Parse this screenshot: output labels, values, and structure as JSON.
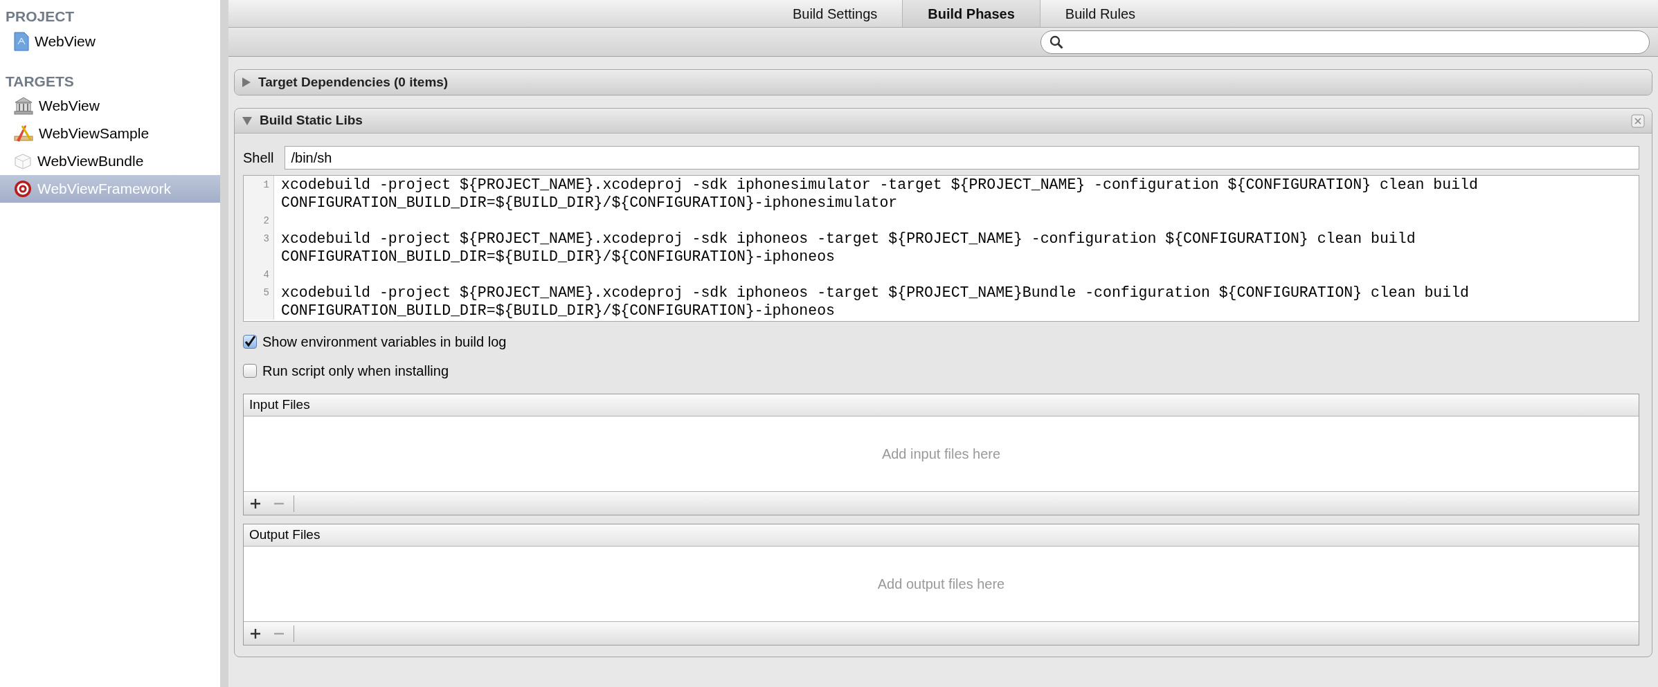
{
  "sidebar": {
    "sections": [
      {
        "heading": "PROJECT",
        "items": [
          {
            "label": "WebView",
            "kind": "project",
            "selected": false
          }
        ]
      },
      {
        "heading": "TARGETS",
        "items": [
          {
            "label": "WebView",
            "kind": "library",
            "selected": false
          },
          {
            "label": "WebViewSample",
            "kind": "app",
            "selected": false
          },
          {
            "label": "WebViewBundle",
            "kind": "bundle",
            "selected": false
          },
          {
            "label": "WebViewFramework",
            "kind": "target",
            "selected": true
          }
        ]
      }
    ]
  },
  "tabs": [
    {
      "label": "Build Settings",
      "selected": false
    },
    {
      "label": "Build Phases",
      "selected": true
    },
    {
      "label": "Build Rules",
      "selected": false
    }
  ],
  "phases": [
    {
      "title": "Target Dependencies (0 items)",
      "expanded": false
    },
    {
      "title": "Build Static Libs",
      "expanded": true,
      "closable": true,
      "shell_label": "Shell",
      "shell": "/bin/sh",
      "script_lines": [
        {
          "number": "1",
          "text": "xcodebuild -project ${PROJECT_NAME}.xcodeproj -sdk iphonesimulator -target ${PROJECT_NAME} -configuration ${CONFIGURATION} clean build CONFIGURATION_BUILD_DIR=${BUILD_DIR}/${CONFIGURATION}-iphonesimulator"
        },
        {
          "number": "2"
        },
        {
          "number": "3",
          "text": "xcodebuild -project ${PROJECT_NAME}.xcodeproj -sdk iphoneos -target ${PROJECT_NAME} -configuration ${CONFIGURATION} clean build CONFIGURATION_BUILD_DIR=${BUILD_DIR}/${CONFIGURATION}-iphoneos"
        },
        {
          "number": "4"
        },
        {
          "number": "5",
          "text": "xcodebuild -project ${PROJECT_NAME}.xcodeproj -sdk iphoneos -target ${PROJECT_NAME}Bundle -configuration ${CONFIGURATION} clean build CONFIGURATION_BUILD_DIR=${BUILD_DIR}/${CONFIGURATION}-iphoneos"
        }
      ],
      "options": [
        {
          "label": "Show environment variables in build log",
          "checked": true
        },
        {
          "label": "Run script only when installing",
          "checked": false
        }
      ],
      "file_lists": [
        {
          "title": "Input Files",
          "empty_text": "Add input files here",
          "remove_enabled": false
        },
        {
          "title": "Output Files",
          "empty_text": "Add output files here",
          "remove_enabled": false
        }
      ]
    }
  ]
}
